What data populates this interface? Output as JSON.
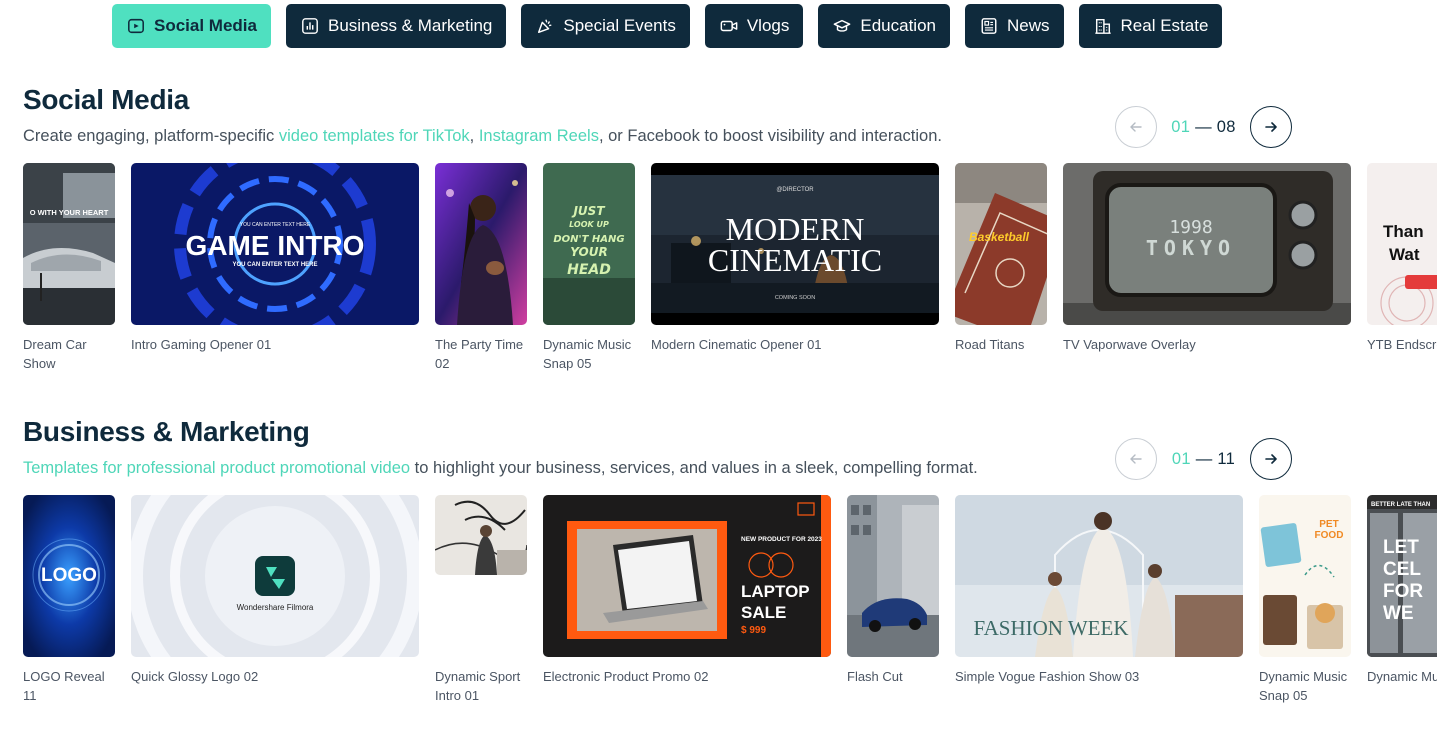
{
  "tabs": [
    {
      "label": "Social Media",
      "icon": "social-media-icon",
      "active": true
    },
    {
      "label": "Business & Marketing",
      "icon": "bar-chart-icon",
      "active": false
    },
    {
      "label": "Special Events",
      "icon": "celebration-icon",
      "active": false
    },
    {
      "label": "Vlogs",
      "icon": "camera-icon",
      "active": false
    },
    {
      "label": "Education",
      "icon": "graduation-cap-icon",
      "active": false
    },
    {
      "label": "News",
      "icon": "newspaper-icon",
      "active": false
    },
    {
      "label": "Real Estate",
      "icon": "building-icon",
      "active": false
    }
  ],
  "colors": {
    "accent": "#4fe0c0",
    "accent_text": "#4fd6b8",
    "navy": "#0f2a3c"
  },
  "social": {
    "title": "Social Media",
    "desc": {
      "p1": "Create engaging, platform-specific ",
      "link1": "video templates for TikTok",
      "p2": ", ",
      "link2": "Instagram Reels",
      "p3": ", or Facebook to boost visibility and interaction."
    },
    "pager": {
      "current": "01",
      "sep": " — ",
      "total": "08"
    },
    "cards": [
      {
        "caption": "Dream Car Show",
        "thumb_text": "O WITH YOUR HEART"
      },
      {
        "caption": "Intro Gaming Opener 01",
        "thumb_text": "GAME INTRO",
        "thumb_sub": "YOU CAN ENTER TEXT HERE",
        "thumb_sub2": "YOU CAN ENTER TEXT HERE"
      },
      {
        "caption": "The Party Time 02"
      },
      {
        "caption": "Dynamic Music Snap 05",
        "thumb_lines": [
          "JUST",
          "LOOK UP",
          "DON'T HANG",
          "YOUR",
          "HEAD"
        ]
      },
      {
        "caption": "Modern Cinematic Opener 01",
        "thumb_small": "@DIRECTOR",
        "thumb_l1": "MODERN",
        "thumb_l2": "CINEMATIC",
        "thumb_foot": "COMING SOON"
      },
      {
        "caption": "Road Titans",
        "thumb_text": "Basketball"
      },
      {
        "caption": "TV Vaporwave Overlay",
        "thumb_l1": "1998",
        "thumb_l2": "TOKYO"
      },
      {
        "caption": "YTB Endscreen",
        "thumb_l1": "Than",
        "thumb_l2": "Wat"
      }
    ]
  },
  "business": {
    "title": "Business & Marketing",
    "desc": {
      "link1": "Templates for professional product promotional video",
      "p1": " to highlight your business, services, and values in a sleek, compelling format."
    },
    "pager": {
      "current": "01",
      "sep": " — ",
      "total": "11"
    },
    "cards": [
      {
        "caption": "LOGO Reveal 11",
        "thumb_text": "LOGO"
      },
      {
        "caption": "Quick Glossy Logo 02",
        "thumb_text": "Wondershare Filmora"
      },
      {
        "caption": "Dynamic Sport Intro 01"
      },
      {
        "caption": "Electronic Product Promo 02",
        "thumb_small": "NEW PRODUCT FOR 2023",
        "thumb_l1": "LAPTOP",
        "thumb_l2": "SALE",
        "thumb_price": "$ 999"
      },
      {
        "caption": "Flash Cut"
      },
      {
        "caption": "Simple Vogue Fashion Show 03",
        "thumb_text": "FASHION WEEK"
      },
      {
        "caption": "Dynamic Music Snap 05",
        "thumb_l1": "PET",
        "thumb_l2": "FOOD"
      },
      {
        "caption": "Dynamic Music",
        "thumb_small": "BETTER LATE THAN",
        "thumb_lines": [
          "LET",
          "CEL",
          "FOR",
          "WE"
        ]
      }
    ]
  }
}
